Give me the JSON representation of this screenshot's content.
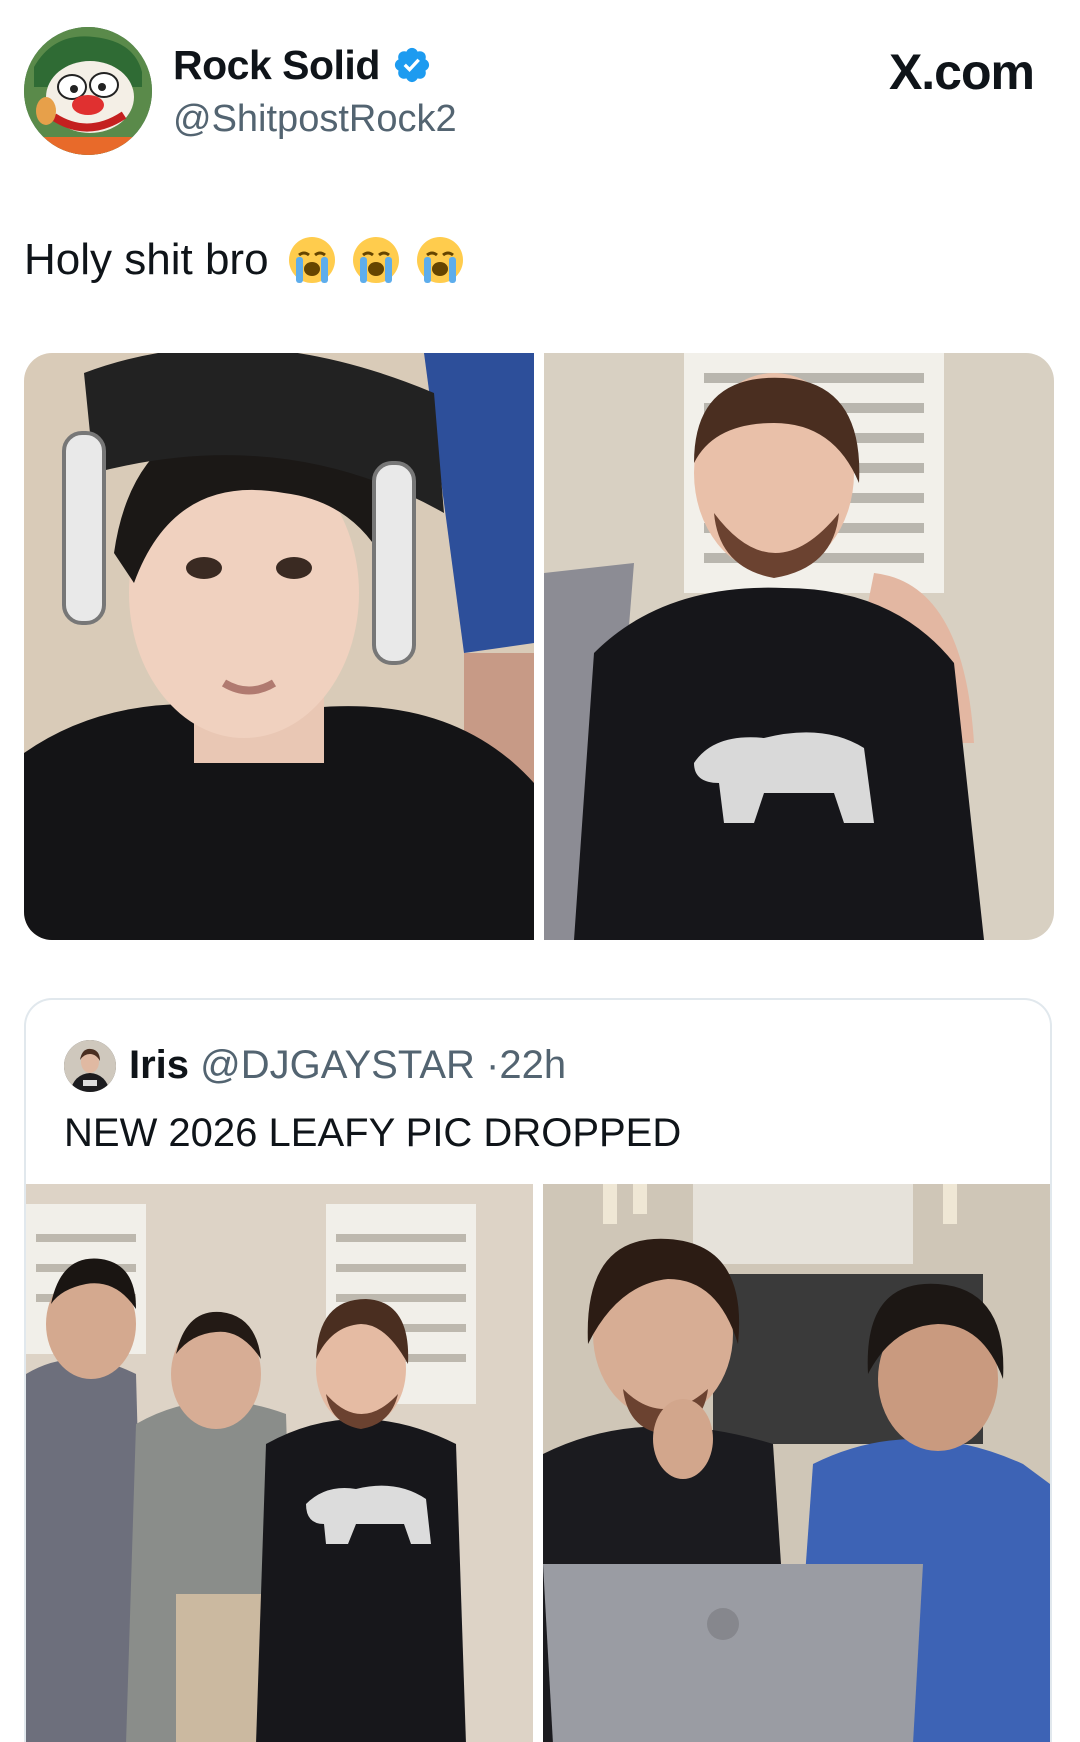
{
  "post": {
    "display_name": "Rock Solid",
    "handle": "@ShitpostRock2",
    "verified": true,
    "text": "Holy shit bro",
    "emojis": [
      "loudly-crying-face",
      "loudly-crying-face",
      "loudly-crying-face"
    ]
  },
  "header": {
    "site_label": "X.com"
  },
  "quoted_post": {
    "display_name": "Iris",
    "handle": "@DJGAYSTAR",
    "separator": "·",
    "time": "22h",
    "text": "NEW 2026 LEAFY PIC DROPPED"
  },
  "colors": {
    "verified_blue": "#1d9bf0",
    "secondary_text": "#536471",
    "border": "#e1e8ed"
  }
}
